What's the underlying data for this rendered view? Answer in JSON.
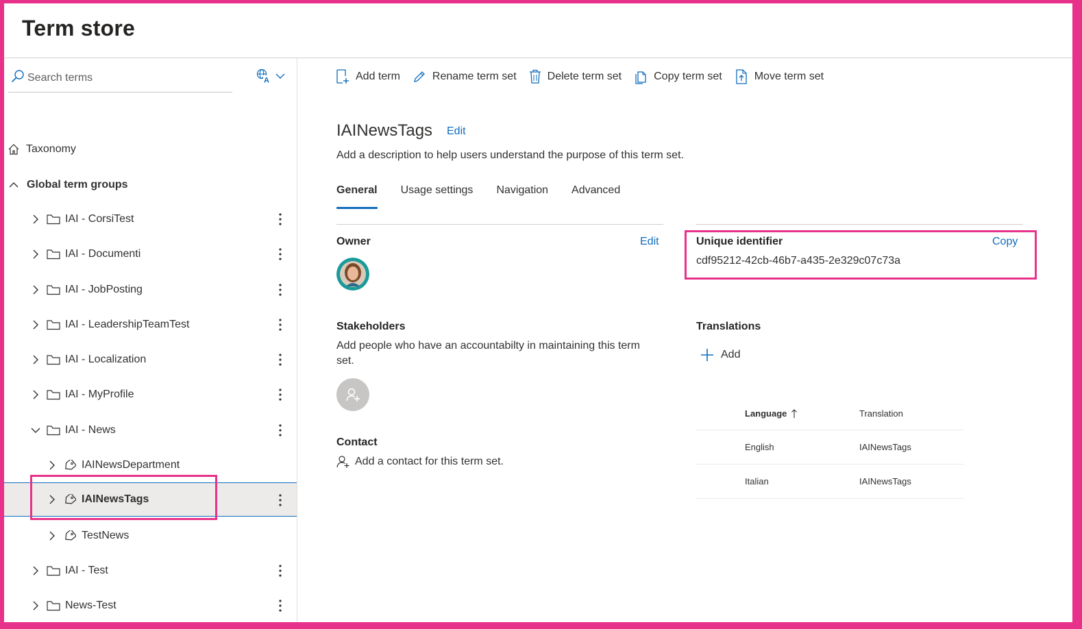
{
  "app": {
    "title": "Term store"
  },
  "search": {
    "placeholder": "Search terms"
  },
  "tree": {
    "taxonomy_label": "Taxonomy",
    "global_groups_label": "Global term groups",
    "groups": [
      {
        "label": "IAI - CorsiTest",
        "expanded": false
      },
      {
        "label": "IAI - Documenti",
        "expanded": false
      },
      {
        "label": "IAI - JobPosting",
        "expanded": false
      },
      {
        "label": "IAI - LeadershipTeamTest",
        "expanded": false
      },
      {
        "label": "IAI - Localization",
        "expanded": false
      },
      {
        "label": "IAI - MyProfile",
        "expanded": false
      },
      {
        "label": "IAI - News",
        "expanded": true
      },
      {
        "label": "IAI - Test",
        "expanded": false
      },
      {
        "label": "News-Test",
        "expanded": false
      }
    ],
    "term_sets": [
      {
        "label": "IAINewsDepartment",
        "selected": false
      },
      {
        "label": "IAINewsTags",
        "selected": true
      },
      {
        "label": "TestNews",
        "selected": false
      }
    ]
  },
  "toolbar": {
    "add_term": "Add term",
    "rename": "Rename term set",
    "delete": "Delete term set",
    "copy": "Copy term set",
    "move": "Move term set"
  },
  "termset": {
    "title": "IAINewsTags",
    "edit_label": "Edit",
    "description": "Add a description to help users understand the purpose of this term set."
  },
  "tabs": [
    {
      "label": "General",
      "active": true
    },
    {
      "label": "Usage settings",
      "active": false
    },
    {
      "label": "Navigation",
      "active": false
    },
    {
      "label": "Advanced",
      "active": false
    }
  ],
  "owner": {
    "label": "Owner",
    "edit_label": "Edit"
  },
  "stakeholders": {
    "label": "Stakeholders",
    "description_line1": "Add people who have an accountabilty in maintaining this term",
    "description_line2": "set."
  },
  "contact": {
    "label": "Contact",
    "add_label": "Add a contact for this term set."
  },
  "unique_identifier": {
    "label": "Unique identifier",
    "copy_label": "Copy",
    "value": "cdf95212-42cb-46b7-a435-2e329c07c73a"
  },
  "translations": {
    "label": "Translations",
    "add_label": "Add",
    "columns": {
      "language": "Language",
      "translation": "Translation"
    },
    "rows": [
      {
        "language": "English",
        "translation": "IAINewsTags"
      },
      {
        "language": "Italian",
        "translation": "IAINewsTags"
      }
    ]
  },
  "colors": {
    "accent": "#0f6cbd",
    "highlight": "#e8318a",
    "selected_bg": "#edebe9"
  }
}
